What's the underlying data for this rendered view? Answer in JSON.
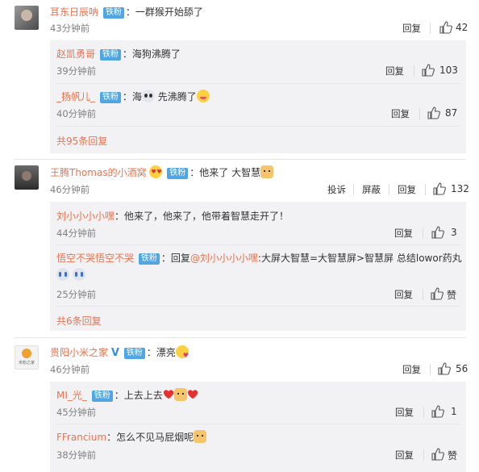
{
  "comments": [
    {
      "user": "耳东日辰呐",
      "badge": "铁粉",
      "text": "一群猴开始舔了",
      "time": "43分钟前",
      "reply_label": "回复",
      "likes": "42",
      "replies": [
        {
          "user": "赵凯勇哥",
          "badge": "铁粉",
          "text": "海狗沸腾了",
          "time": "39分钟前",
          "reply_label": "回复",
          "likes": "103"
        },
        {
          "user": "_扬帆儿_",
          "badge": "铁粉",
          "text_a": "海",
          "text_b": "先沸腾了",
          "time": "40分钟前",
          "reply_label": "回复",
          "likes": "87"
        }
      ],
      "more": "共95条回复"
    },
    {
      "user": "王腾Thomas的小酒窝",
      "badge": "铁粉",
      "text": "他来了 大智慧",
      "time": "46分钟前",
      "report_label": "投诉",
      "block_label": "屏蔽",
      "reply_label": "回复",
      "likes": "132",
      "replies": [
        {
          "user": "刘小小小小嘿",
          "text": "他来了，他来了，他带着智慧走开了！",
          "time": "44分钟前",
          "reply_label": "回复",
          "likes": "3"
        },
        {
          "user": "悟空不哭悟空不哭",
          "badge": "铁粉",
          "text_prefix": "回复",
          "mention": "@刘小小小小嘿",
          "text": "大屏大智慧=大智慧屏>智慧屏 总结lowor药丸",
          "time": "25分钟前",
          "reply_label": "回复",
          "likes": "赞"
        }
      ],
      "more": "共6条回复"
    },
    {
      "user": "贵阳小米之家",
      "badge": "铁粉",
      "text": "漂亮",
      "time": "46分钟前",
      "reply_label": "回复",
      "likes": "56",
      "avatar_text": "米粉之家",
      "replies": [
        {
          "user": "MI_光_",
          "badge": "铁粉",
          "text": "上去上去",
          "time": "45分钟前",
          "reply_label": "回复",
          "likes": "1"
        },
        {
          "user": "FFrancium",
          "text": "怎么不见马屁烟呢",
          "time": "38分钟前",
          "reply_label": "回复",
          "likes": "赞"
        }
      ]
    }
  ],
  "colors": {
    "username": "#eb7350",
    "badge": "#4fa6e3",
    "subbox": "#f2f2f5",
    "verified": "#3a8dde"
  }
}
